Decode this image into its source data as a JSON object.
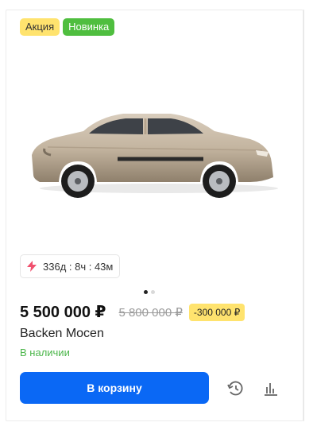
{
  "badges": {
    "sale": "Акция",
    "new": "Новинка"
  },
  "timer": {
    "text": "336д : 8ч : 43м"
  },
  "product": {
    "price": "5 500 000 ₽",
    "old_price": "5 800 000 ₽",
    "discount": "-300 000 ₽",
    "title": "Backen Mocen",
    "availability": "В наличии"
  },
  "actions": {
    "cart_label": "В корзину"
  },
  "icons": {
    "timer": "lightning-icon",
    "history": "history-icon",
    "compare": "compare-chart-icon"
  },
  "colors": {
    "accent": "#0a68f5",
    "sale": "#ffe36e",
    "new": "#4fbe3f",
    "in_stock": "#4bb64a",
    "lightning": "#f0506e"
  },
  "gallery": {
    "total": 2,
    "active": 1
  }
}
